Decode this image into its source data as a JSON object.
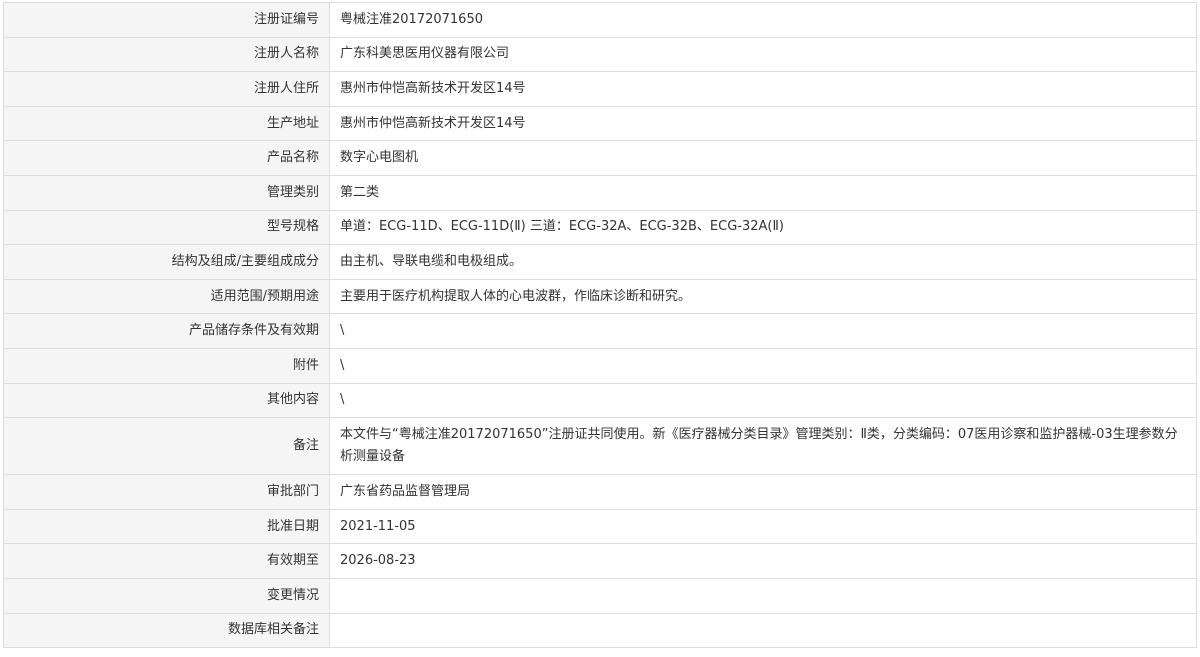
{
  "rows": [
    {
      "label": "注册证编号",
      "value": "粤械注准20172071650"
    },
    {
      "label": "注册人名称",
      "value": "广东科美思医用仪器有限公司"
    },
    {
      "label": "注册人住所",
      "value": "惠州市仲恺高新技术开发区14号"
    },
    {
      "label": "生产地址",
      "value": "惠州市仲恺高新技术开发区14号"
    },
    {
      "label": "产品名称",
      "value": "数字心电图机"
    },
    {
      "label": "管理类别",
      "value": "第二类"
    },
    {
      "label": "型号规格",
      "value": "单道：ECG-11D、ECG-11D(Ⅱ) 三道：ECG-32A、ECG-32B、ECG-32A(Ⅱ)"
    },
    {
      "label": "结构及组成/主要组成成分",
      "value": "由主机、导联电缆和电极组成。"
    },
    {
      "label": "适用范围/预期用途",
      "value": "主要用于医疗机构提取人体的心电波群，作临床诊断和研究。"
    },
    {
      "label": "产品储存条件及有效期",
      "value": "\\"
    },
    {
      "label": "附件",
      "value": "\\"
    },
    {
      "label": "其他内容",
      "value": "\\"
    },
    {
      "label": "备注",
      "value": "本文件与“粤械注准20172071650”注册证共同使用。新《医疗器械分类目录》管理类别：Ⅱ类，分类编码：07医用诊察和监护器械-03生理参数分析测量设备"
    },
    {
      "label": "审批部门",
      "value": "广东省药品监督管理局"
    },
    {
      "label": "批准日期",
      "value": "2021-11-05"
    },
    {
      "label": "有效期至",
      "value": "2026-08-23"
    },
    {
      "label": "变更情况",
      "value": ""
    },
    {
      "label": "数据库相关备注",
      "value": ""
    }
  ]
}
